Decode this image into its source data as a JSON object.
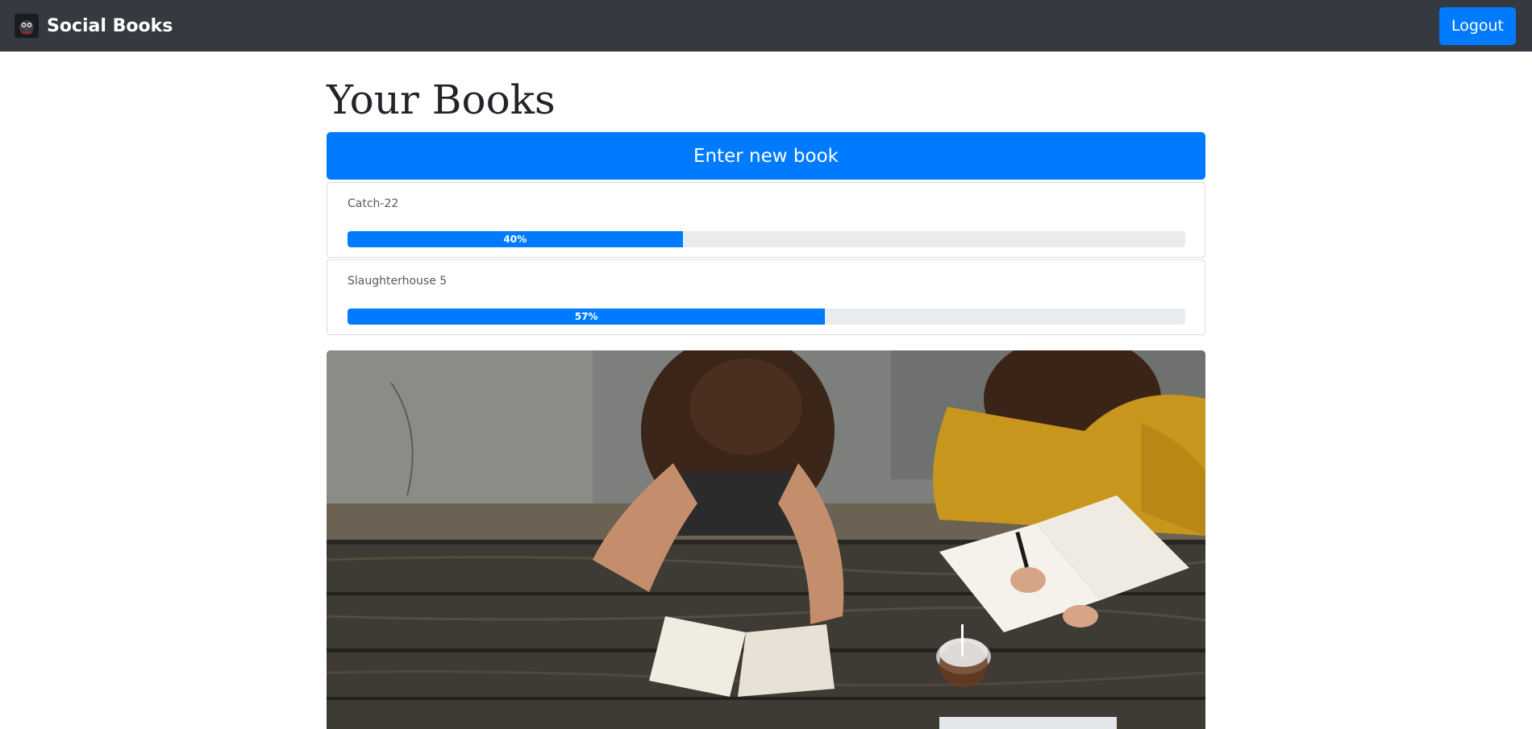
{
  "navbar": {
    "brand_name": "Social Books",
    "logo_icon": "owl-logo-icon",
    "logout_label": "Logout"
  },
  "main": {
    "title": "Your Books",
    "new_book_label": "Enter new book",
    "books": [
      {
        "title": "Catch-22",
        "progress": 40,
        "progress_label": "40%"
      },
      {
        "title": "Slaughterhouse 5",
        "progress": 57,
        "progress_label": "57%"
      }
    ]
  },
  "hero": {
    "image": "two-women-reading-at-wooden-table-photo"
  },
  "colors": {
    "navbar": "#343a40",
    "primary": "#007bff",
    "progress_track": "#e9ecef"
  }
}
